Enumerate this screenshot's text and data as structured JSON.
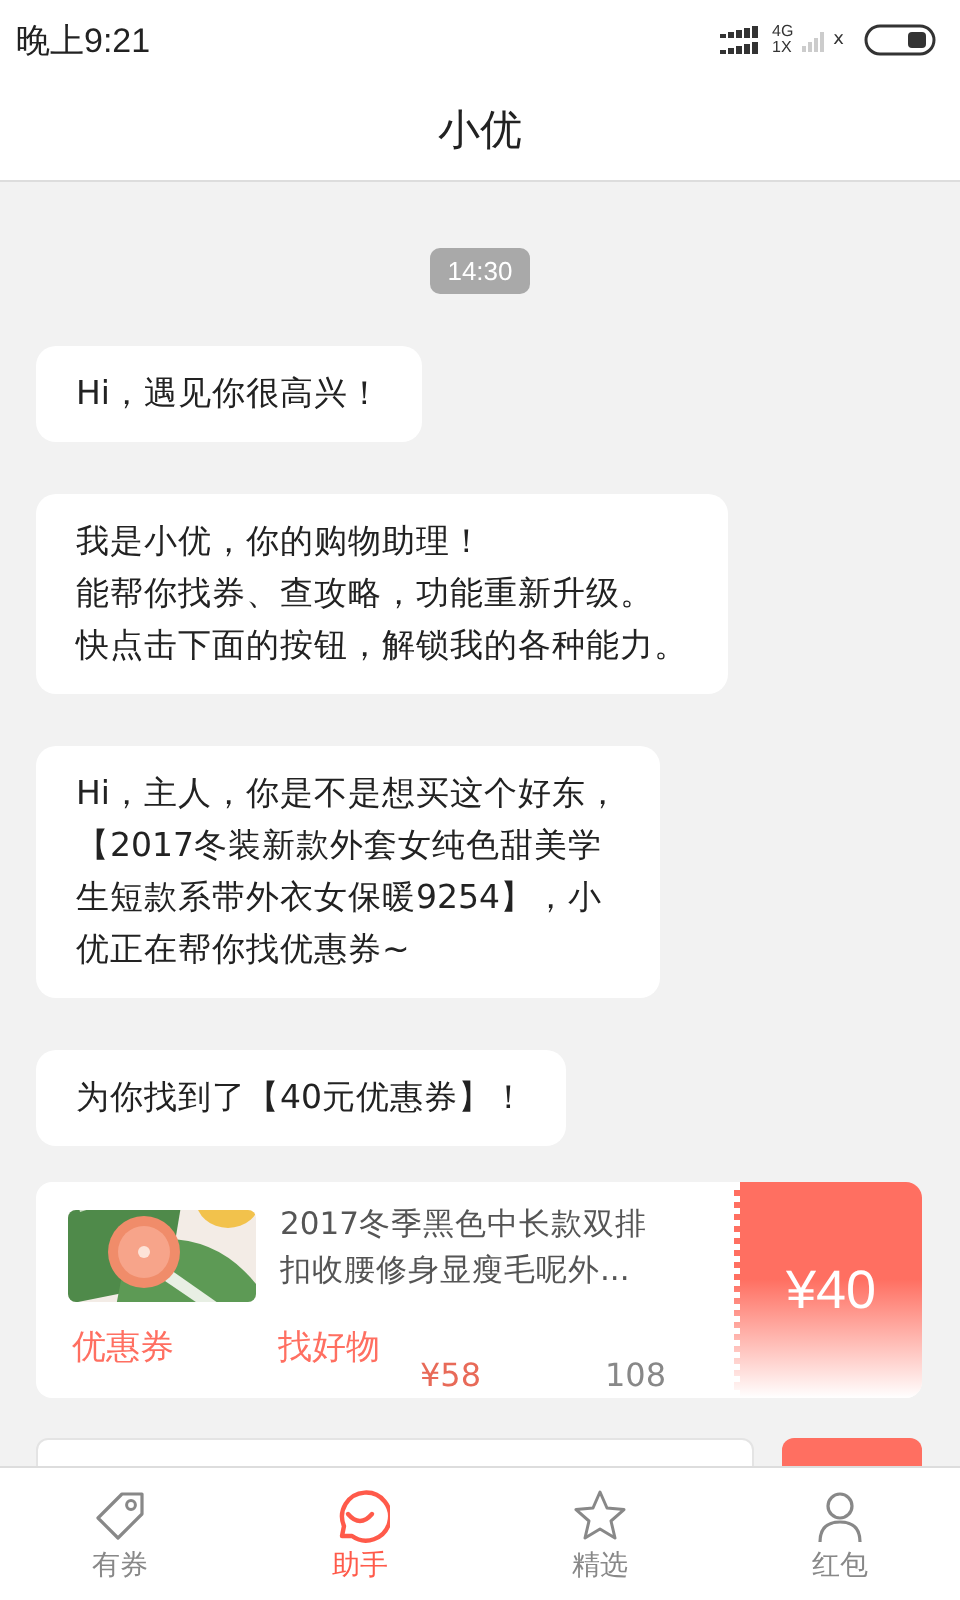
{
  "status_bar": {
    "time": "晚上9:21",
    "network_1": "4G",
    "network_2": "1X",
    "network_3": "x"
  },
  "header": {
    "title": "小优"
  },
  "chat": {
    "timestamp": "14:30",
    "messages": [
      {
        "lines": [
          "Hi，遇见你很高兴！"
        ]
      },
      {
        "lines": [
          "我是小优，你的购物助理！",
          "能帮你找券、查攻略，功能重新升级。",
          "快点击下面的按钮，解锁我的各种能力。"
        ]
      },
      {
        "lines": [
          "Hi，主人，你是不是想买这个好东，",
          "【2017冬装新款外套女纯色甜美学",
          "生短款系带外衣女保暖9254】，小",
          "优正在帮你找优惠券~"
        ]
      },
      {
        "lines": [
          "为你找到了【40元优惠券】！"
        ]
      }
    ],
    "product": {
      "title": "2017冬季黑色中长款双排扣收腰修身显瘦毛呢外...",
      "price": "¥58",
      "sold": "108",
      "coupon": "¥40"
    },
    "quick_replies": [
      "优惠券",
      "找好物"
    ]
  },
  "tabs": [
    {
      "label": "有券",
      "kind": "tag",
      "selected": false
    },
    {
      "label": "助手",
      "kind": "smile",
      "selected": true
    },
    {
      "label": "精选",
      "kind": "star",
      "selected": false
    },
    {
      "label": "红包",
      "kind": "person",
      "selected": false
    }
  ]
}
